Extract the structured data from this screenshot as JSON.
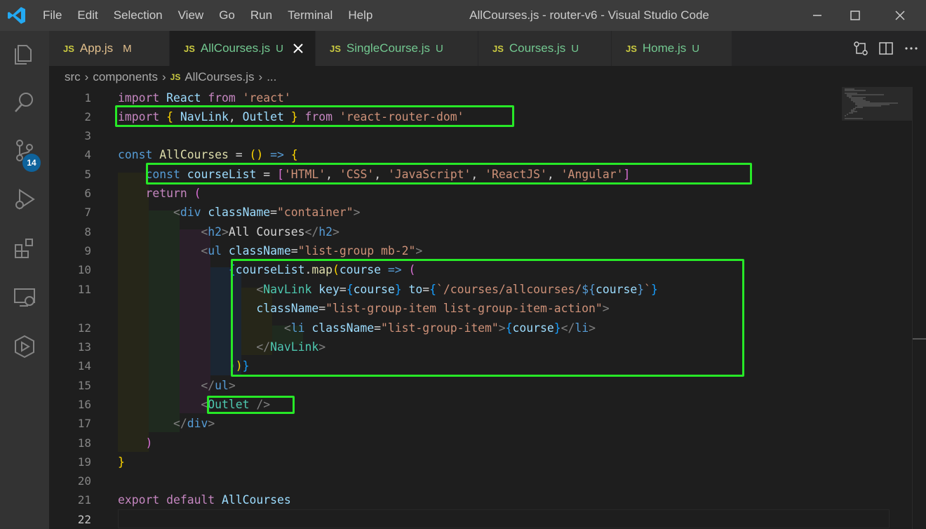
{
  "titlebar": {
    "menu": [
      "File",
      "Edit",
      "Selection",
      "View",
      "Go",
      "Run",
      "Terminal",
      "Help"
    ],
    "window_title": "AllCourses.js - router-v6 - Visual Studio Code"
  },
  "activity_bar": {
    "items": [
      "explorer-icon",
      "search-icon",
      "source-control-icon",
      "run-debug-icon",
      "extensions-icon",
      "remote-explorer-icon",
      "deploy-icon"
    ],
    "source_control_badge": "14"
  },
  "tabs": [
    {
      "icon": "JS",
      "label": "App.js",
      "status": "M",
      "status_color": "#e2c08d",
      "label_color": "#e2c08d",
      "active": false
    },
    {
      "icon": "JS",
      "label": "AllCourses.js",
      "status": "U",
      "status_color": "#73c991",
      "label_color": "#73c991",
      "active": true
    },
    {
      "icon": "JS",
      "label": "SingleCourse.js",
      "status": "U",
      "status_color": "#73c991",
      "label_color": "#73c991",
      "active": false
    },
    {
      "icon": "JS",
      "label": "Courses.js",
      "status": "U",
      "status_color": "#73c991",
      "label_color": "#73c991",
      "active": false
    },
    {
      "icon": "JS",
      "label": "Home.js",
      "status": "U",
      "status_color": "#73c991",
      "label_color": "#73c991",
      "active": false
    }
  ],
  "breadcrumb": {
    "parts": [
      "src",
      "components"
    ],
    "file_icon": "JS",
    "file": "AllCourses.js",
    "more": "..."
  },
  "editor": {
    "line_numbers": [
      "1",
      "2",
      "3",
      "4",
      "5",
      "6",
      "7",
      "8",
      "9",
      "10",
      "11",
      "",
      "12",
      "13",
      "14",
      "15",
      "16",
      "17",
      "18",
      "19",
      "20",
      "21",
      "22"
    ]
  },
  "colors": {
    "highlight": "#27e827",
    "accent": "#0e639c"
  }
}
